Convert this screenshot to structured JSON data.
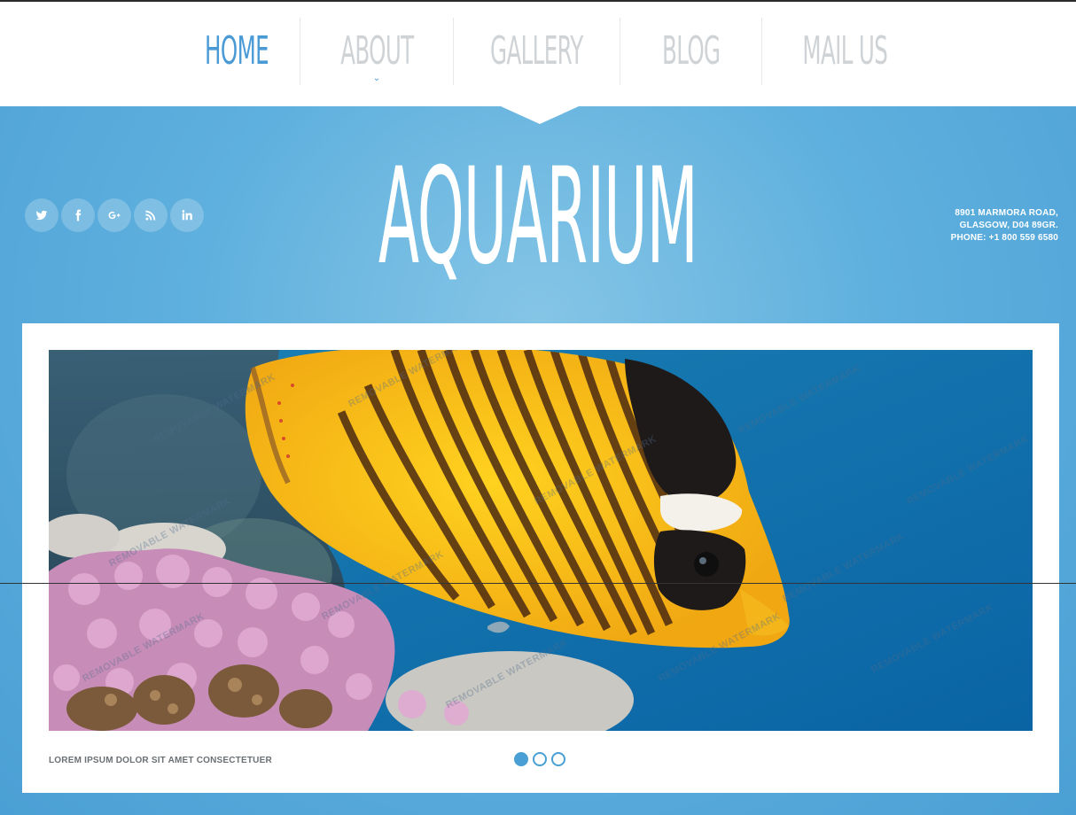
{
  "nav": {
    "items": [
      {
        "label": "HOME",
        "active": true
      },
      {
        "label": "ABOUT",
        "active": false,
        "has_dropdown": true
      },
      {
        "label": "GALLERY",
        "active": false
      },
      {
        "label": "BLOG",
        "active": false
      },
      {
        "label": "MAIL US",
        "active": false
      }
    ]
  },
  "hero": {
    "title": "AQUARIUM",
    "socials": [
      "twitter-icon",
      "facebook-icon",
      "google-plus-icon",
      "rss-icon",
      "linkedin-icon"
    ],
    "contact": {
      "line1": "8901 MARMORA ROAD,",
      "line2": "GLASGOW, D04 89GR.",
      "line3": "PHONE: +1 800 559 6580"
    }
  },
  "slider": {
    "caption": "LOREM IPSUM DOLOR SIT AMET CONSECTETUER",
    "watermark": "REMOVABLE WATERMARK",
    "slide_count": 3,
    "active_slide": 1
  },
  "colors": {
    "accent": "#4a9ad6",
    "nav_inactive": "#cfd3d6",
    "hero_bg": "#5fb0de"
  }
}
